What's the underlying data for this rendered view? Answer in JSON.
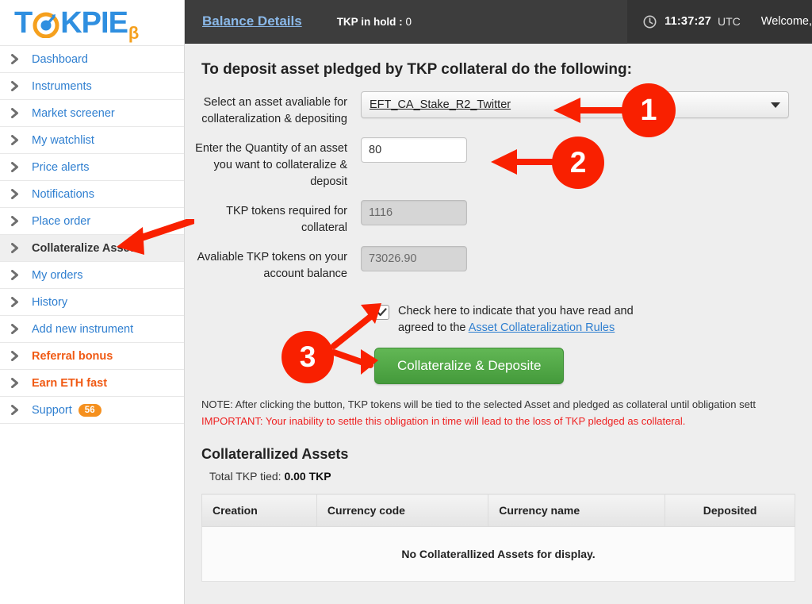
{
  "brand": {
    "logo_text_1": "T",
    "logo_text_2": "KPIE",
    "logo_beta": "β",
    "blue": "#2f8fe0",
    "orange": "#f5a01e"
  },
  "header": {
    "balance_details": "Balance Details",
    "tkp_in_hold_label": "TKP in hold :",
    "tkp_in_hold_value": "0",
    "clock_icon": "clock-icon",
    "time": "11:37:27",
    "timezone": "UTC",
    "welcome": "Welcome, "
  },
  "sidebar": {
    "items": [
      {
        "label": "Dashboard",
        "style": "link",
        "active": false
      },
      {
        "label": "Instruments",
        "style": "link",
        "active": false
      },
      {
        "label": "Market screener",
        "style": "link",
        "active": false
      },
      {
        "label": "My watchlist",
        "style": "link",
        "active": false
      },
      {
        "label": "Price alerts",
        "style": "link",
        "active": false
      },
      {
        "label": "Notifications",
        "style": "link",
        "active": false
      },
      {
        "label": "Place order",
        "style": "link",
        "active": false
      },
      {
        "label": "Collateralize Asset",
        "style": "active",
        "active": true
      },
      {
        "label": "My orders",
        "style": "link",
        "active": false
      },
      {
        "label": "History",
        "style": "link",
        "active": false
      },
      {
        "label": "Add new instrument",
        "style": "link",
        "active": false
      },
      {
        "label": "Referral bonus",
        "style": "orange",
        "active": false
      },
      {
        "label": "Earn ETH fast",
        "style": "orange",
        "active": false
      },
      {
        "label": "Support",
        "style": "link",
        "active": false,
        "badge": "56"
      }
    ]
  },
  "main": {
    "title": "To deposit asset pledged by TKP collateral do the following:",
    "fields": {
      "asset_label": "Select an asset avaliable for collateralization & depositing",
      "asset_value": "EFT_CA_Stake_R2_Twitter",
      "quantity_label": "Enter the Quantity of an asset you want to collateralize & deposit",
      "quantity_value": "80",
      "tkp_required_label": "TKP tokens required for collateral",
      "tkp_required_value": "1116",
      "tkp_available_label": "Avaliable TKP tokens on your account balance",
      "tkp_available_value": "73026.90"
    },
    "checkbox": {
      "checked": true,
      "text_before": "Check here to indicate that you have read and agreed to the ",
      "link_text": "Asset Collateralization Rules"
    },
    "submit_label": "Collateralize & Deposite",
    "note": "NOTE: After clicking the button, TKP tokens will be tied to the selected Asset and pledged as collateral until obligation sett",
    "important": "IMPORTANT: Your inability to settle this obligation in time will lead to the loss of TKP pledged as collateral.",
    "section_title": "Collaterallized Assets",
    "total_label": "Total TKP tied:",
    "total_value": "0.00 TKP",
    "table": {
      "columns": [
        "Creation",
        "Currency code",
        "Currency name",
        "Deposited"
      ],
      "empty_message": "No Collaterallized Assets for display.",
      "rows": []
    }
  },
  "annotations": {
    "color": "#f92000",
    "marker_1": "1",
    "marker_2": "2",
    "marker_3": "3"
  }
}
